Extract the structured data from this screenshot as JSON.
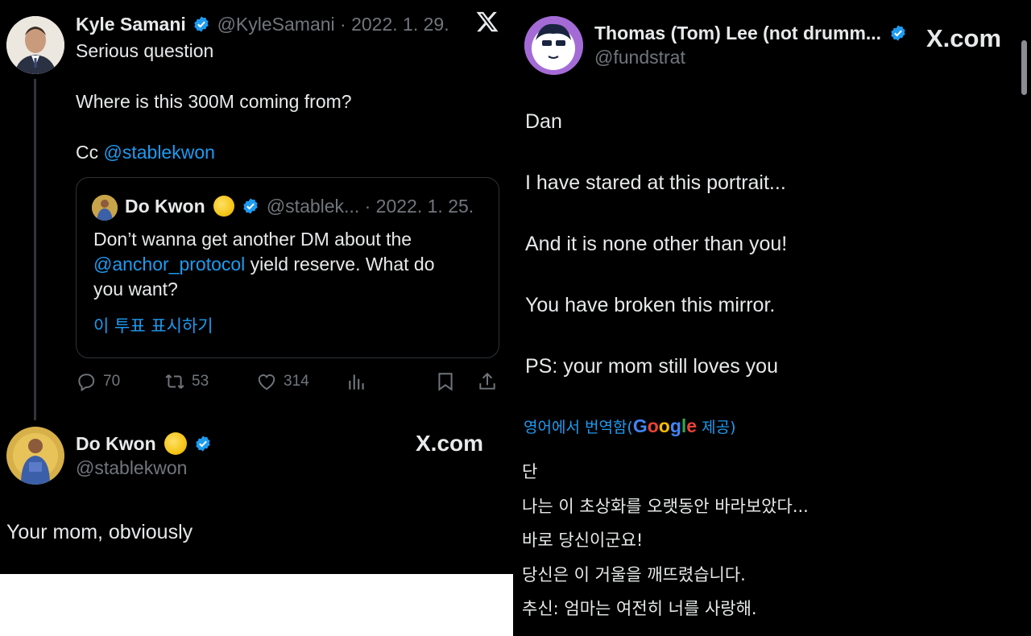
{
  "left_tweet": {
    "author_name": "Kyle Samani",
    "handle": "@KyleSamani",
    "date": "· 2022. 1. 29.",
    "line1": "Serious question",
    "line2": "Where is this 300M coming from?",
    "cc_prefix": "Cc ",
    "cc_mention": "@stablekwon",
    "quote": {
      "author_name": "Do Kwon",
      "handle": "@stablek...",
      "date": "· 2022. 1. 25.",
      "line1": "Don’t wanna get another DM about the",
      "mention": "@anchor_protocol",
      "line2_rest": " yield reserve. What do",
      "line3": "you want?",
      "show_poll": "이 투표 표시하기"
    },
    "actions": {
      "replies": "70",
      "retweets": "53",
      "likes": "314"
    }
  },
  "reply_tweet": {
    "author_name": "Do Kwon",
    "handle": "@stablekwon",
    "text": "Your mom, obviously",
    "brand": "X.com"
  },
  "right_tweet": {
    "author_name": "Thomas (Tom) Lee (not drumm...",
    "handle": "@fundstrat",
    "brand": "X.com",
    "lines": [
      "Dan",
      "I have stared at this portrait...",
      "And it is none other than you!",
      "You have broken this mirror.",
      "PS: your mom still loves you"
    ],
    "translation_prefix": "영어에서 번역함(",
    "translation_provider": "Google",
    "translation_suffix": " 제공)",
    "korean_lines": [
      "단",
      "나는 이 초상화를 오랫동안 바라보았다...",
      "바로 당신이군요!",
      "당신은 이 거울을 깨뜨렸습니다.",
      "추신: 엄마는 여전히 너를 사랑해."
    ]
  },
  "colors": {
    "background": "#000000",
    "text": "#e7e9ea",
    "muted": "#71767b",
    "link": "#1d9bf0",
    "verified": "#1d9bf0",
    "sun_emoji": "#f5c518"
  },
  "icons": [
    "x-logo-icon",
    "verified-badge-icon",
    "reply-icon",
    "retweet-icon",
    "like-icon",
    "views-icon",
    "bookmark-icon",
    "share-icon",
    "sun-emoji-icon"
  ]
}
